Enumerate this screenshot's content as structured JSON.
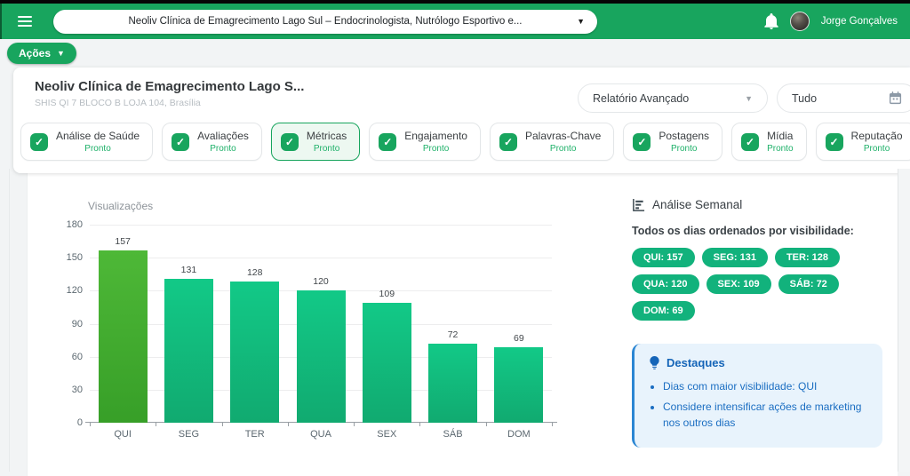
{
  "topbar": {
    "business_selector": "Neoliv Clínica de Emagrecimento Lago Sul – Endocrinologista, Nutrólogo Esportivo e...",
    "user_name": "Jorge Gonçalves"
  },
  "actions": {
    "label": "Ações"
  },
  "report_header": {
    "title": "Neoliv Clínica de Emagrecimento Lago S...",
    "address": "SHIS QI 7 BLOCO B LOJA 104, Brasília",
    "report_type_selected": "Relatório Avançado",
    "date_range_selected": "Tudo"
  },
  "tabs": [
    {
      "label": "Análise de Saúde",
      "status": "Pronto",
      "selected": false
    },
    {
      "label": "Avaliações",
      "status": "Pronto",
      "selected": false
    },
    {
      "label": "Métricas",
      "status": "Pronto",
      "selected": true
    },
    {
      "label": "Engajamento",
      "status": "Pronto",
      "selected": false
    },
    {
      "label": "Palavras-Chave",
      "status": "Pronto",
      "selected": false
    },
    {
      "label": "Postagens",
      "status": "Pronto",
      "selected": false
    },
    {
      "label": "Mídia",
      "status": "Pronto",
      "selected": false
    },
    {
      "label": "Reputação",
      "status": "Pronto",
      "selected": false
    }
  ],
  "chart_data": {
    "type": "bar",
    "title": "Visualizações",
    "categories": [
      "QUI",
      "SEG",
      "TER",
      "QUA",
      "SEX",
      "SÁB",
      "DOM"
    ],
    "values": [
      157,
      131,
      128,
      120,
      109,
      72,
      69
    ],
    "ylim": [
      0,
      180
    ],
    "yticks": [
      0,
      30,
      60,
      90,
      120,
      150,
      180
    ],
    "grid": true,
    "legend": "none",
    "highlight_category": "QUI",
    "bar_color": "#12c987",
    "highlight_color": "#46af31"
  },
  "weekly_panel": {
    "title": "Análise Semanal",
    "subtitle": "Todos os dias ordenados por visibilidade:",
    "badges": [
      "QUI: 157",
      "SEG: 131",
      "TER: 128",
      "QUA: 120",
      "SEX: 109",
      "SÁB: 72",
      "DOM: 69"
    ]
  },
  "highlights": {
    "title": "Destaques",
    "items": [
      "Dias com maior visibilidade: QUI",
      "Considere intensificar ações de marketing nos outros dias"
    ]
  },
  "colors": {
    "primary_green": "#18a55e",
    "badge_green": "#12b27c",
    "bar_green": "#12c987",
    "bar_highlight_green": "#46af31",
    "status_green": "#1db068",
    "info_blue": "#1b6ec2",
    "info_bg": "#e8f3fc"
  }
}
